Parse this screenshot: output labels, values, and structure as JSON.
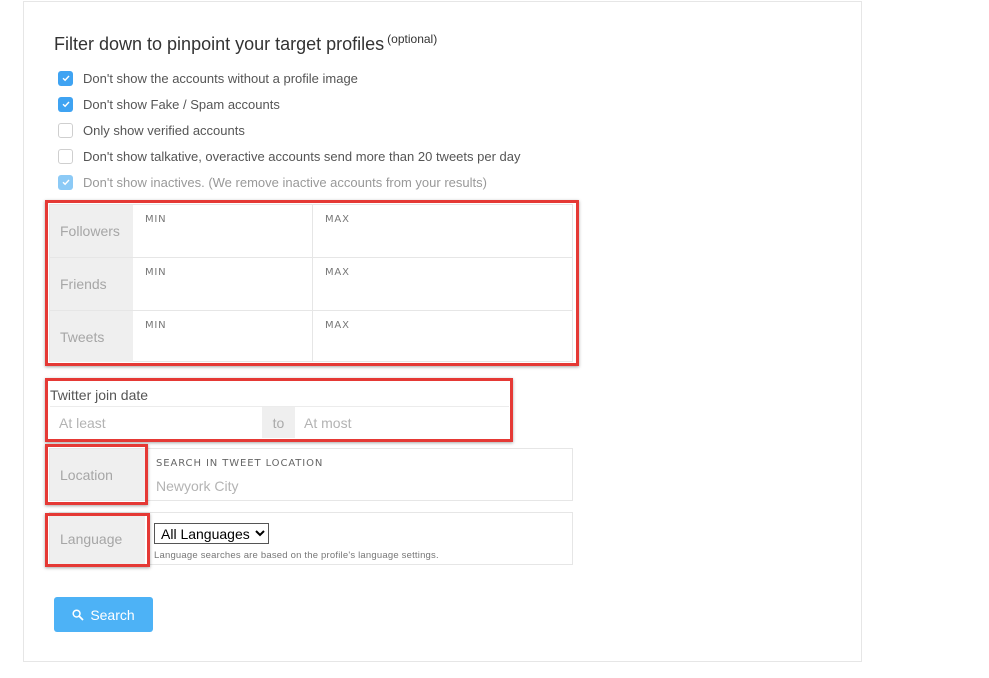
{
  "filters": {
    "title": "Filter down to pinpoint your target profiles",
    "title_suffix": "(optional)",
    "checkboxes": [
      {
        "label": "Don't show the accounts without a profile image",
        "checked": true,
        "disabled": false
      },
      {
        "label": "Don't show Fake / Spam accounts",
        "checked": true,
        "disabled": false
      },
      {
        "label": "Only show verified accounts",
        "checked": false,
        "disabled": false
      },
      {
        "label": "Don't show talkative, overactive accounts send more than 20 tweets per day",
        "checked": false,
        "disabled": false
      },
      {
        "label": "Don't show inactives. (We remove inactive accounts from your results)",
        "checked": true,
        "disabled": true
      }
    ]
  },
  "ranges": [
    {
      "label": "Followers",
      "min_label": "MIN",
      "max_label": "MAX"
    },
    {
      "label": "Friends",
      "min_label": "MIN",
      "max_label": "MAX"
    },
    {
      "label": "Tweets",
      "min_label": "MIN",
      "max_label": "MAX"
    }
  ],
  "join_date": {
    "label": "Twitter join date",
    "from_placeholder": "At least",
    "separator": "to",
    "to_placeholder": "At most"
  },
  "location": {
    "label": "Location",
    "field_label": "SEARCH IN TWEET LOCATION",
    "placeholder": "Newyork City"
  },
  "language": {
    "label": "Language",
    "selected": "All Languages",
    "note": "Language searches are based on the profile's language settings."
  },
  "actions": {
    "search_label": "Search",
    "search_icon": "search-icon"
  },
  "colors": {
    "accent": "#3fa3f2",
    "button": "#4db2f6",
    "highlight_box": "#e53935"
  }
}
